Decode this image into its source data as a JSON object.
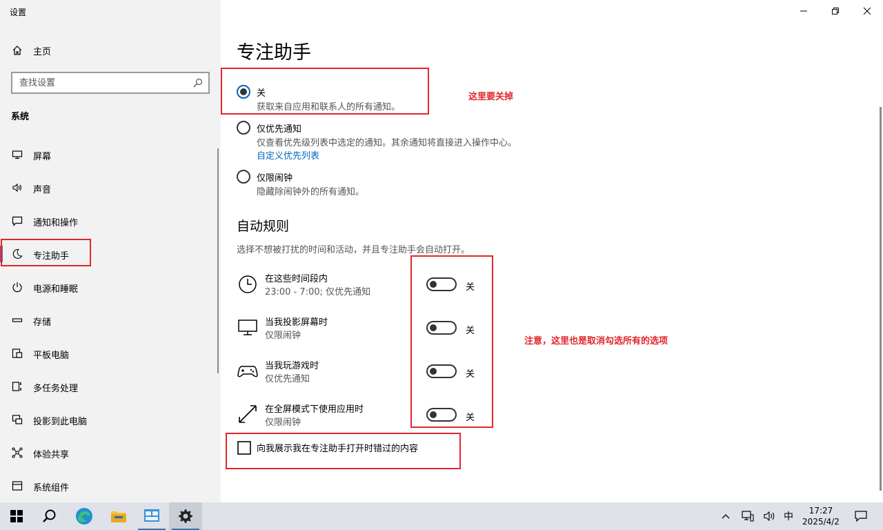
{
  "window": {
    "title": "设置"
  },
  "sidebar": {
    "home_label": "主页",
    "search_placeholder": "查找设置",
    "section_title": "系统",
    "items": [
      {
        "label": "屏幕",
        "icon": "monitor-icon"
      },
      {
        "label": "声音",
        "icon": "speaker-icon"
      },
      {
        "label": "通知和操作",
        "icon": "message-icon"
      },
      {
        "label": "专注助手",
        "icon": "moon-icon",
        "active": true
      },
      {
        "label": "电源和睡眠",
        "icon": "power-icon"
      },
      {
        "label": "存储",
        "icon": "storage-icon"
      },
      {
        "label": "平板电脑",
        "icon": "tablet-icon"
      },
      {
        "label": "多任务处理",
        "icon": "multitask-icon"
      },
      {
        "label": "投影到此电脑",
        "icon": "project-icon"
      },
      {
        "label": "体验共享",
        "icon": "share-icon"
      },
      {
        "label": "系统组件",
        "icon": "component-icon"
      }
    ]
  },
  "main": {
    "title": "专注助手",
    "options": [
      {
        "label": "关",
        "desc": "获取来自应用和联系人的所有通知。",
        "checked": true
      },
      {
        "label": "仅优先通知",
        "desc": "仅查看优先级列表中选定的通知。其余通知将直接进入操作中心。",
        "link": "自定义优先列表",
        "checked": false
      },
      {
        "label": "仅限闹钟",
        "desc": "隐藏除闹钟外的所有通知。",
        "checked": false
      }
    ],
    "auto_rules": {
      "title": "自动规则",
      "desc": "选择不想被打扰的时间和活动，并且专注助手会自动打开。",
      "rules": [
        {
          "name": "在这些时间段内",
          "sub": "23:00 - 7:00; 仅优先通知",
          "state": "关",
          "icon": "clock-icon"
        },
        {
          "name": "当我投影屏幕时",
          "sub": "仅限闹钟",
          "state": "关",
          "icon": "monitor-icon"
        },
        {
          "name": "当我玩游戏时",
          "sub": "仅优先通知",
          "state": "关",
          "icon": "gamepad-icon"
        },
        {
          "name": "在全屏模式下使用应用时",
          "sub": "仅限闹钟",
          "state": "关",
          "icon": "fullscreen-icon"
        }
      ]
    },
    "checkbox_label": "向我展示我在专注助手打开时错过的内容"
  },
  "annotations": {
    "note1": "这里要关掉",
    "note2": "注意，这里也是取消勾选所有的选项",
    "color": "#e0262a"
  },
  "taskbar": {
    "ime": "中",
    "time": "17:27",
    "date": "2025/4/2"
  }
}
